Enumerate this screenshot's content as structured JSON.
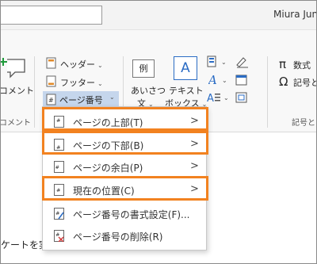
{
  "window": {
    "user_name": "Miura Jun"
  },
  "ribbon": {
    "comment_label": "コメント",
    "comment_group_label": "コメント",
    "header_label": "ヘッダー",
    "footer_label": "フッター",
    "page_number_label": "ページ番号",
    "greeting_line1": "あいさつ",
    "greeting_line2": "文",
    "textbox_line1": "テキスト",
    "textbox_line2": "ボックス",
    "equation_label": "数式",
    "symbol_label": "記号と",
    "symbol_group_label": "記号と",
    "example_icon_text": "例",
    "pi_glyph": "π",
    "omega_glyph": "Ω",
    "a_glyph": "A"
  },
  "menu": {
    "items": [
      {
        "label": "ページの上部(T)",
        "arrow": ">"
      },
      {
        "label": "ページの下部(B)",
        "arrow": ">"
      },
      {
        "label": "ページの余白(P)",
        "arrow": ">"
      },
      {
        "label": "現在の位置(C)",
        "arrow": ">"
      },
      {
        "label": "ページ番号の書式設定(F)...",
        "arrow": ""
      },
      {
        "label": "ページ番号の削除(R)",
        "arrow": ""
      }
    ]
  },
  "document": {
    "visible_text": "ケートを実施。"
  },
  "colors": {
    "highlight": "#f28220",
    "accent_blue": "#2b6cc4",
    "accent_green": "#1e9a3a"
  }
}
